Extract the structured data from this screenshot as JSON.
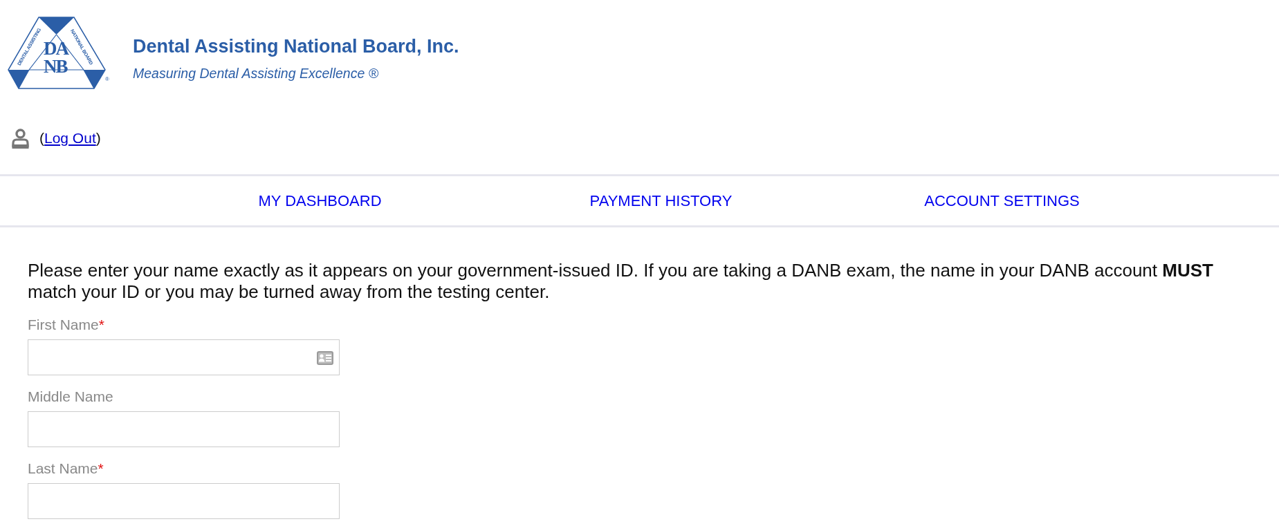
{
  "header": {
    "logo": {
      "monogram": "DANB",
      "left_band": "DENTAL ASSISTING",
      "right_band": "NATIONAL BOARD",
      "mark": "®"
    },
    "title": "Dental Assisting National Board, Inc.",
    "tagline": "Measuring Dental Assisting Excellence ®"
  },
  "account": {
    "before": "(",
    "link": "Log Out",
    "after": ")"
  },
  "nav": [
    {
      "label": "MY DASHBOARD"
    },
    {
      "label": "PAYMENT HISTORY"
    },
    {
      "label": "ACCOUNT SETTINGS"
    }
  ],
  "intro": "Please enter your name exactly as it appears on your government-issued ID. If you are taking a DANB exam, the name in your DANB account **MUST** match your ID or you may be turned away from the testing center.",
  "fields": [
    {
      "label": "First Name",
      "required_mark": "*",
      "autofill_icon": true
    },
    {
      "label": "Middle Name",
      "autofill_icon": false
    },
    {
      "label": "Last Name",
      "required_mark": "*",
      "autofill_icon": false
    }
  ]
}
